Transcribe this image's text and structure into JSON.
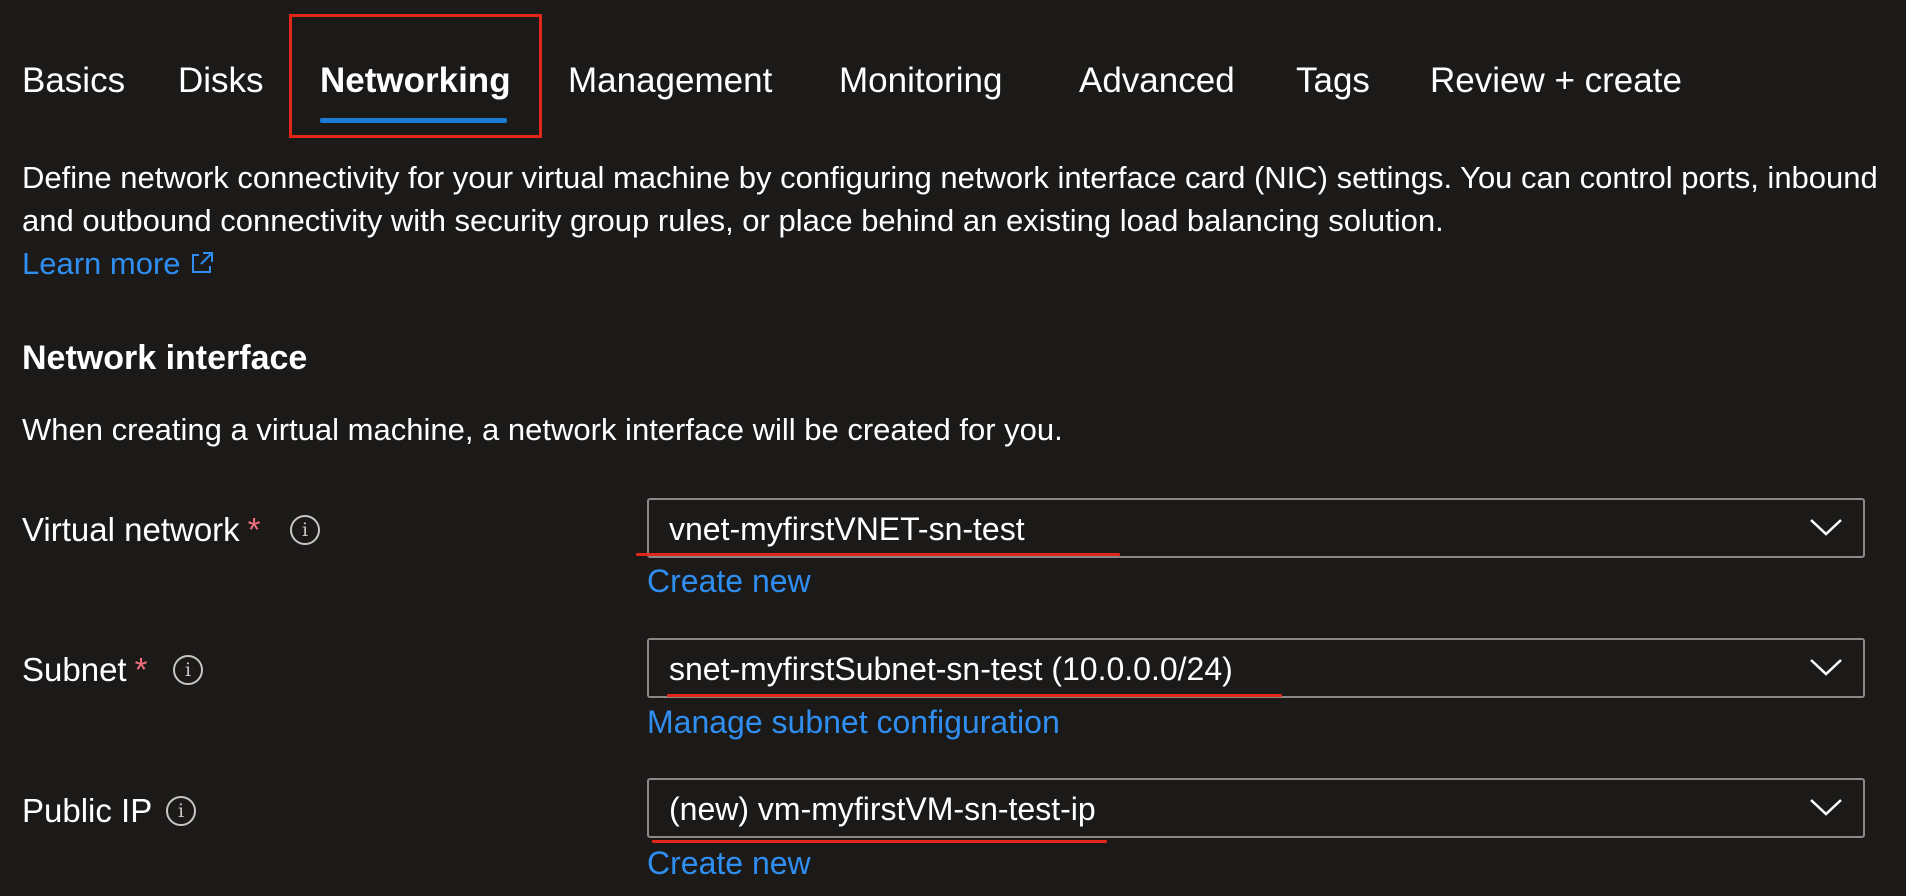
{
  "tabs": [
    {
      "label": "Basics"
    },
    {
      "label": "Disks"
    },
    {
      "label": "Networking",
      "active": true
    },
    {
      "label": "Management"
    },
    {
      "label": "Monitoring"
    },
    {
      "label": "Advanced"
    },
    {
      "label": "Tags"
    },
    {
      "label": "Review + create"
    }
  ],
  "description": "Define network connectivity for your virtual machine by configuring network interface card (NIC) settings. You can control ports, inbound and outbound connectivity with security group rules, or place behind an existing load balancing solution.",
  "learn_more": {
    "label": "Learn more",
    "icon": "external-link-icon"
  },
  "network_interface": {
    "title": "Network interface",
    "description": "When creating a virtual machine, a network interface will be created for you."
  },
  "fields": {
    "virtual_network": {
      "label": "Virtual network",
      "required_mark": "*",
      "info_glyph": "i",
      "value": "vnet-myfirstVNET-sn-test",
      "link": "Create new"
    },
    "subnet": {
      "label": "Subnet",
      "required_mark": "*",
      "info_glyph": "i",
      "value": "snet-myfirstSubnet-sn-test (10.0.0.0/24)",
      "link": "Manage subnet configuration"
    },
    "public_ip": {
      "label": "Public IP",
      "info_glyph": "i",
      "value": "(new) vm-myfirstVM-sn-test-ip",
      "link": "Create new"
    }
  },
  "colors": {
    "background": "#1b1a19",
    "accent": "#1b7bd4",
    "link": "#2f8ef0",
    "annotation_red": "#e3261a",
    "required": "#f1707b"
  }
}
